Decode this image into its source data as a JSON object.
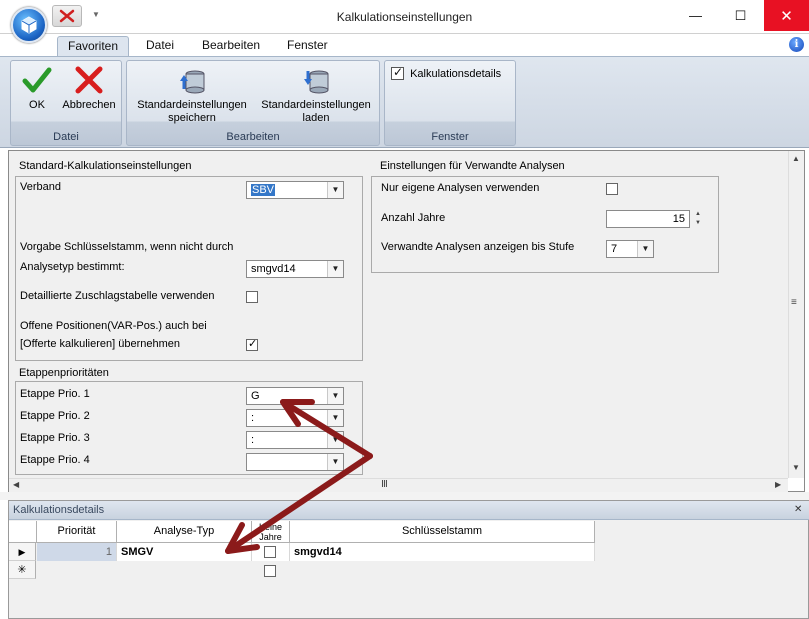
{
  "window": {
    "title": "Kalkulationseinstellungen",
    "minimize": "—",
    "maximize": "☐",
    "close": "✕"
  },
  "ribbon": {
    "tabs": [
      "Favoriten",
      "Datei",
      "Bearbeiten",
      "Fenster"
    ],
    "active_tab": "Favoriten",
    "groups": {
      "datei": {
        "label": "Datei",
        "ok": "OK",
        "cancel": "Abbrechen"
      },
      "bearbeiten": {
        "label": "Bearbeiten",
        "save_defaults_l1": "Standardeinstellungen",
        "save_defaults_l2": "speichern",
        "load_defaults_l1": "Standardeinstellungen",
        "load_defaults_l2": "laden"
      },
      "fenster": {
        "label": "Fenster",
        "details_checkbox": "Kalkulationsdetails",
        "details_checked": true
      }
    }
  },
  "standard": {
    "title": "Standard-Kalkulationseinstellungen",
    "verband_label": "Verband",
    "verband_value": "SBV",
    "schluessel_label_l1": "Vorgabe Schlüsselstamm, wenn nicht durch",
    "schluessel_label_l2": "Analysetyp bestimmt:",
    "schluessel_value": "smgvd14",
    "zuschlag_label": "Detaillierte Zuschlagstabelle verwenden",
    "zuschlag_checked": false,
    "offene_label_l1": "Offene Positionen(VAR-Pos.) auch bei",
    "offene_label_l2": "[Offerte kalkulieren] übernehmen",
    "offene_checked": true
  },
  "etappen": {
    "title": "Etappenprioritäten",
    "prio1_label": "Etappe Prio. 1",
    "prio1_value": "G",
    "prio2_label": "Etappe Prio. 2",
    "prio2_value": ":",
    "prio3_label": "Etappe Prio. 3",
    "prio3_value": ":",
    "prio4_label": "Etappe Prio. 4",
    "prio4_value": ""
  },
  "verwandte": {
    "title": "Einstellungen für Verwandte Analysen",
    "eigene_label": "Nur eigene Analysen verwenden",
    "eigene_checked": false,
    "jahre_label": "Anzahl Jahre",
    "jahre_value": "15",
    "stufe_label": "Verwandte Analysen anzeigen bis Stufe",
    "stufe_value": "7"
  },
  "grid": {
    "caption": "Kalkulationsdetails",
    "columns": [
      "Priorität",
      "Analyse-Typ",
      "Keine Jahre",
      "Schlüsselstamm"
    ],
    "rows": [
      {
        "prioritaet": "1",
        "analysetyp": "SMGV",
        "keine_jahre": false,
        "schluesselstamm": "smgvd14"
      }
    ],
    "new_row_marker": "✳"
  },
  "annotation_color": "#8b1a1a"
}
